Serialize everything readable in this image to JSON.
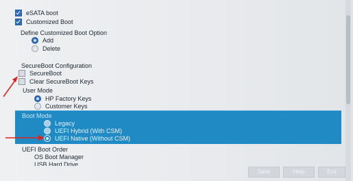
{
  "options": {
    "esata_boot": {
      "label": "eSATA boot",
      "checked": true
    },
    "customized_boot": {
      "label": "Customized Boot",
      "checked": true
    }
  },
  "define_customized_boot": {
    "heading": "Define Customized Boot Option",
    "choices": [
      {
        "label": "Add",
        "selected": true
      },
      {
        "label": "Delete",
        "selected": false
      }
    ]
  },
  "secureboot_config": {
    "heading": "SecureBoot Configuration",
    "secureboot": {
      "label": "SecureBoot",
      "checked": false
    },
    "clear_keys": {
      "label": "Clear SecureBoot Keys",
      "checked": false
    }
  },
  "user_mode": {
    "heading": "User Mode",
    "choices": [
      {
        "label": "HP Factory Keys",
        "selected": true
      },
      {
        "label": "Customer Keys",
        "selected": false
      }
    ]
  },
  "boot_mode": {
    "heading": "Boot Mode",
    "choices": [
      {
        "label": "Legacy",
        "selected": false
      },
      {
        "label": "UEFI Hybrid (With CSM)",
        "selected": false
      },
      {
        "label": "UEFI Native (Without CSM)",
        "selected": true
      }
    ]
  },
  "uefi_boot_order": {
    "heading": "UEFI Boot Order",
    "items": [
      "OS Boot Manager",
      "USB Hard Drive"
    ]
  },
  "footer_buttons": {
    "save": "Save",
    "help": "Help",
    "exit": "Exit"
  },
  "colors": {
    "highlight_band": "#1f8ac4",
    "annotation_arrow": "#e0211b",
    "check_fill": "#2f6cb8"
  }
}
